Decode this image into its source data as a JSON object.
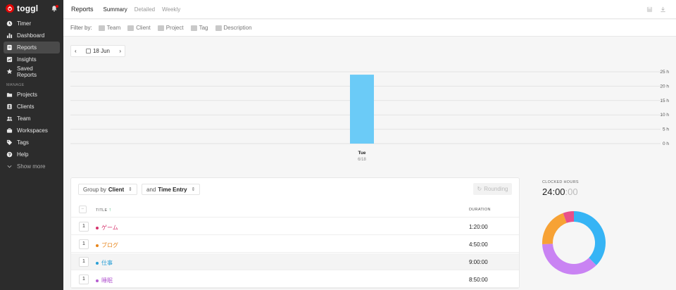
{
  "app": {
    "name": "toggl"
  },
  "sidebar": {
    "items": [
      {
        "id": "timer",
        "label": "Timer",
        "icon": "clock-icon"
      },
      {
        "id": "dashboard",
        "label": "Dashboard",
        "icon": "bar-chart-icon"
      },
      {
        "id": "reports",
        "label": "Reports",
        "icon": "document-icon",
        "active": true
      },
      {
        "id": "insights",
        "label": "Insights",
        "icon": "insights-icon"
      },
      {
        "id": "saved-reports",
        "label": "Saved Reports",
        "icon": "star-icon"
      }
    ],
    "section_label": "MANAGE",
    "manage": [
      {
        "id": "projects",
        "label": "Projects",
        "icon": "folder-icon"
      },
      {
        "id": "clients",
        "label": "Clients",
        "icon": "contact-card-icon"
      },
      {
        "id": "team",
        "label": "Team",
        "icon": "people-icon"
      },
      {
        "id": "workspaces",
        "label": "Workspaces",
        "icon": "briefcase-icon"
      },
      {
        "id": "tags",
        "label": "Tags",
        "icon": "tag-icon"
      },
      {
        "id": "help",
        "label": "Help",
        "icon": "help-icon"
      }
    ],
    "show_more": "Show more"
  },
  "topbar": {
    "title": "Reports",
    "tabs": [
      "Summary",
      "Detailed",
      "Weekly"
    ],
    "active_tab": "Summary"
  },
  "filters": {
    "label": "Filter by:",
    "items": [
      "Team",
      "Client",
      "Project",
      "Tag",
      "Description"
    ]
  },
  "date": {
    "label": "18 Jun"
  },
  "chart_data": {
    "type": "bar",
    "categories": [
      "Tue"
    ],
    "sublabels": [
      "6/18"
    ],
    "values": [
      24
    ],
    "ylim": [
      0,
      25
    ],
    "yticks": [
      "0 h",
      "5 h",
      "10 h",
      "15 h",
      "20 h",
      "25 h"
    ],
    "ytick_values": [
      0,
      5,
      10,
      15,
      20,
      25
    ],
    "color": "#6bcbf7",
    "grid": true
  },
  "table": {
    "group_by_prefix": "Group by",
    "group_by_value": "Client",
    "and_prefix": "and",
    "and_value": "Time Entry",
    "rounding": "Rounding",
    "header_title": "TITLE",
    "header_duration": "DURATION",
    "rows": [
      {
        "count": "1",
        "title": "ゲーム",
        "duration": "1:20:00",
        "color": "#d6336c"
      },
      {
        "count": "1",
        "title": "ブログ",
        "duration": "4:50:00",
        "color": "#e8851a"
      },
      {
        "count": "1",
        "title": "仕事",
        "duration": "9:00:00",
        "color": "#2a9fd6"
      },
      {
        "count": "1",
        "title": "睡眠",
        "duration": "8:50:00",
        "color": "#b55dd1"
      }
    ]
  },
  "clocked": {
    "label": "CLOCKED HOURS",
    "value_main": "24:00",
    "value_dim": ":00"
  },
  "donut_data": {
    "type": "pie",
    "segments": [
      {
        "name": "仕事",
        "value": 9.0,
        "color": "#36b4f5"
      },
      {
        "name": "睡眠",
        "value": 8.8333,
        "color": "#c983f3"
      },
      {
        "name": "ブログ",
        "value": 4.8333,
        "color": "#f7a235"
      },
      {
        "name": "ゲーム",
        "value": 1.3333,
        "color": "#e8508a"
      }
    ]
  }
}
